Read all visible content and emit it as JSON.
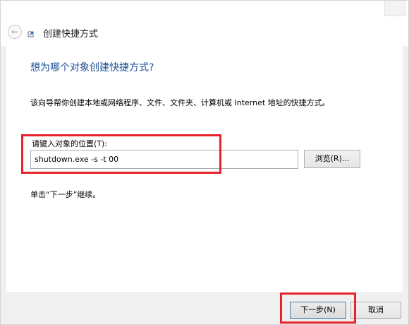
{
  "window": {
    "title": "创建快捷方式"
  },
  "page": {
    "heading": "想为哪个对象创建快捷方式?",
    "description": "该向导帮你创建本地或网络程序、文件、文件夹、计算机或 Internet 地址的快捷方式。",
    "location_label": "请键入对象的位置(T):",
    "location_value": "shutdown.exe -s -t 00",
    "browse_label": "浏览(R)...",
    "continue_text": "单击“下一步”继续。"
  },
  "footer": {
    "next_label": "下一步(N)",
    "cancel_label": "取消"
  },
  "icons": {
    "back": "back-arrow-icon",
    "title": "shortcut-icon"
  },
  "colors": {
    "heading": "#1e4f9a",
    "highlight": "#e8232b",
    "default_button_border": "#3c7fb1"
  }
}
